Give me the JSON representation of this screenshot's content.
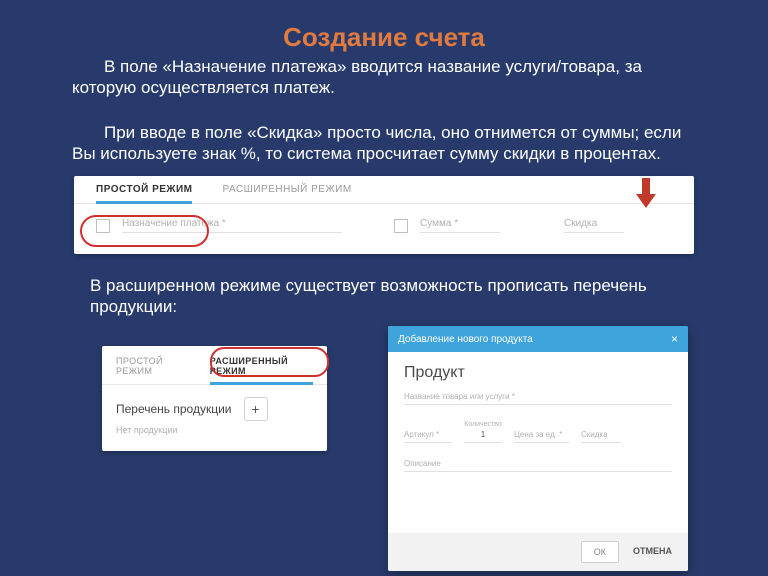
{
  "title": "Создание счета",
  "para1": "В поле «Назначение платежа» вводится название услуги/товара, за которую осуществляется платеж.",
  "para2": "При вводе в поле «Скидка» просто числа, оно отнимется от суммы; если Вы используете знак %, то система просчитает сумму скидки в процентах.",
  "para3": "В расширенном режиме существует возможность прописать перечень продукции:",
  "embed1": {
    "tabs": {
      "simple": "ПРОСТОЙ РЕЖИМ",
      "advanced": "РАСШИРЕННЫЙ РЕЖИМ"
    },
    "fields": {
      "purpose": "Назначение платежа *",
      "amount": "Сумма *",
      "discount": "Скидка"
    }
  },
  "embed2": {
    "tabs": {
      "simple": "ПРОСТОЙ РЕЖИМ",
      "advanced": "РАСШИРЕННЫЙ РЕЖИМ"
    },
    "list_label": "Перечень продукции",
    "plus": "+",
    "empty": "Нет продукции"
  },
  "modal": {
    "header": "Добавление нового продукта",
    "close": "×",
    "heading": "Продукт",
    "fields": {
      "name": "Название товара или услуги *",
      "article": "Артикул *",
      "qty_label": "Количество",
      "qty_value": "1",
      "price": "Цена за ед. *",
      "discount": "Скидка",
      "description": "Описание"
    },
    "buttons": {
      "ok": "ОК",
      "cancel": "ОТМЕНА"
    }
  }
}
